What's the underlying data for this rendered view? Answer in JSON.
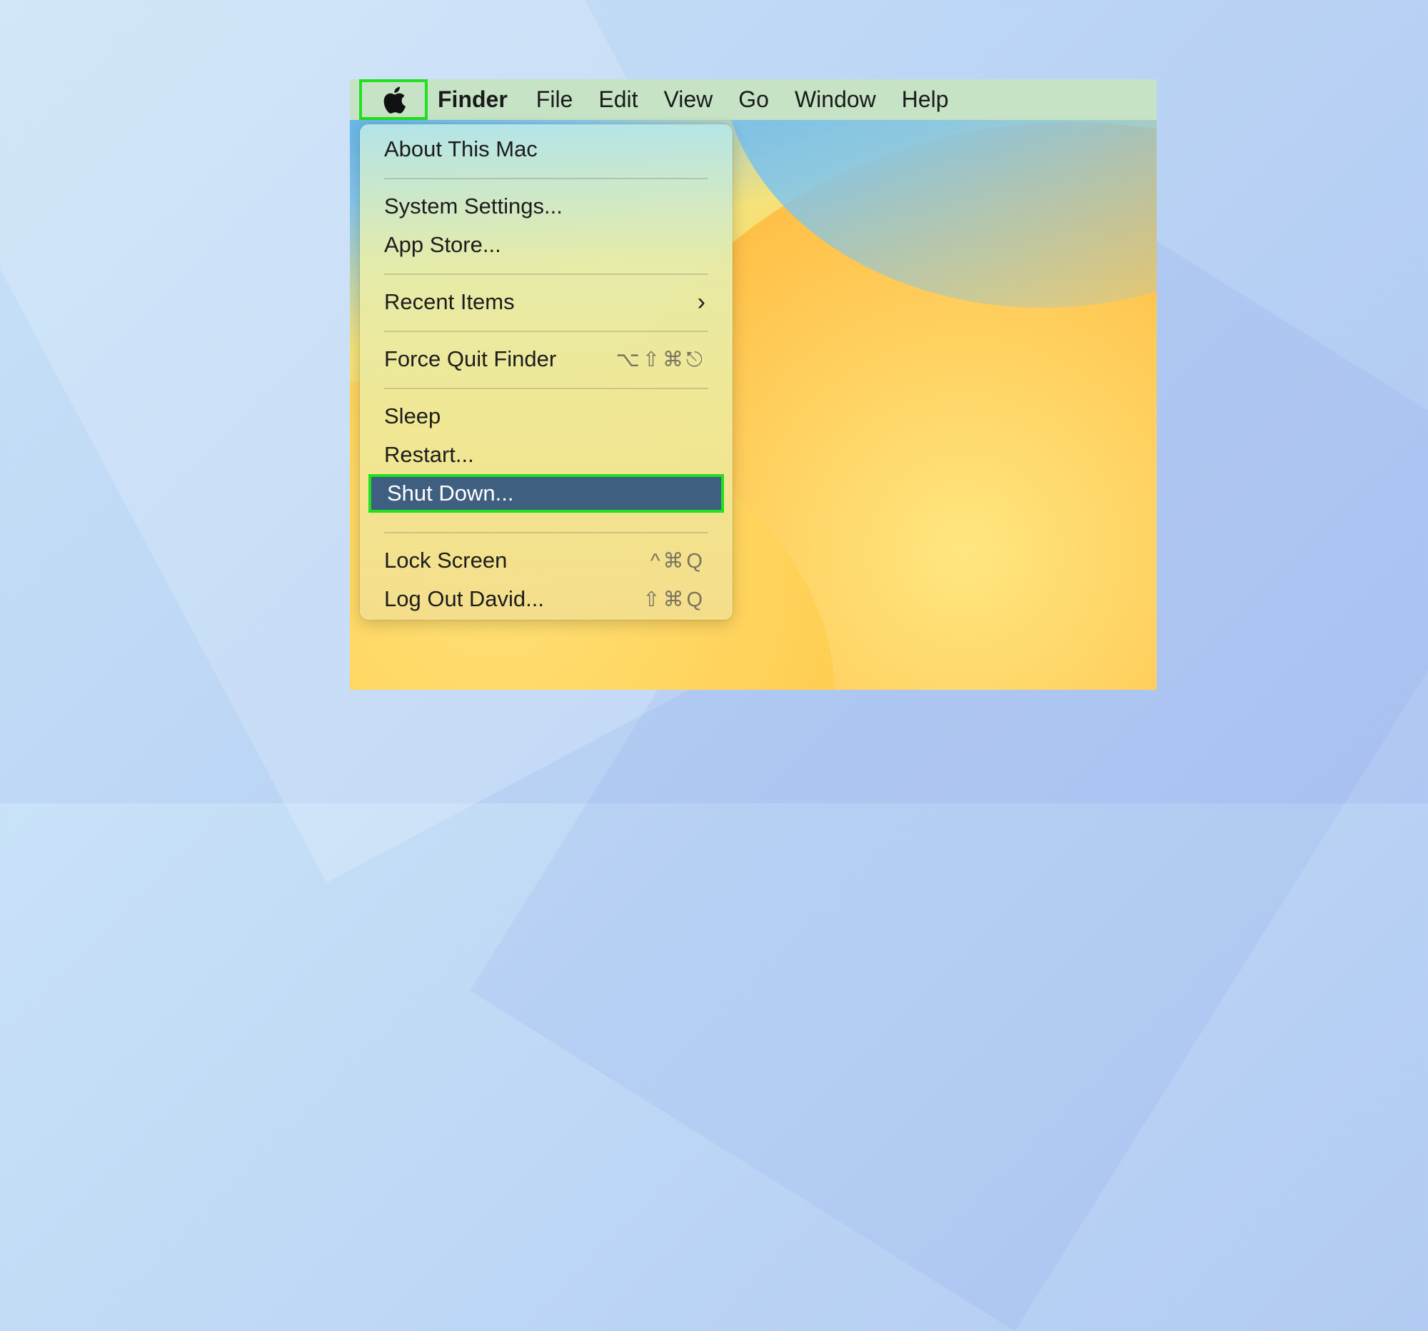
{
  "menubar": {
    "apple_menu_icon": "apple-logo-icon",
    "app_name": "Finder",
    "items": [
      "File",
      "Edit",
      "View",
      "Go",
      "Window",
      "Help"
    ]
  },
  "apple_menu": {
    "about": "About This Mac",
    "system_settings": "System Settings...",
    "app_store": "App Store...",
    "recent_items": "Recent Items",
    "recent_items_chevron": "›",
    "force_quit": "Force Quit Finder",
    "force_quit_shortcut": "⌥⇧⌘⎋",
    "sleep": "Sleep",
    "restart": "Restart...",
    "shut_down": "Shut Down...",
    "lock_screen": "Lock Screen",
    "lock_screen_shortcut": "^⌘Q",
    "log_out": "Log Out David...",
    "log_out_shortcut": "⇧⌘Q"
  },
  "highlight_color": "#20e020",
  "selected_item_color": "#3f5f80"
}
